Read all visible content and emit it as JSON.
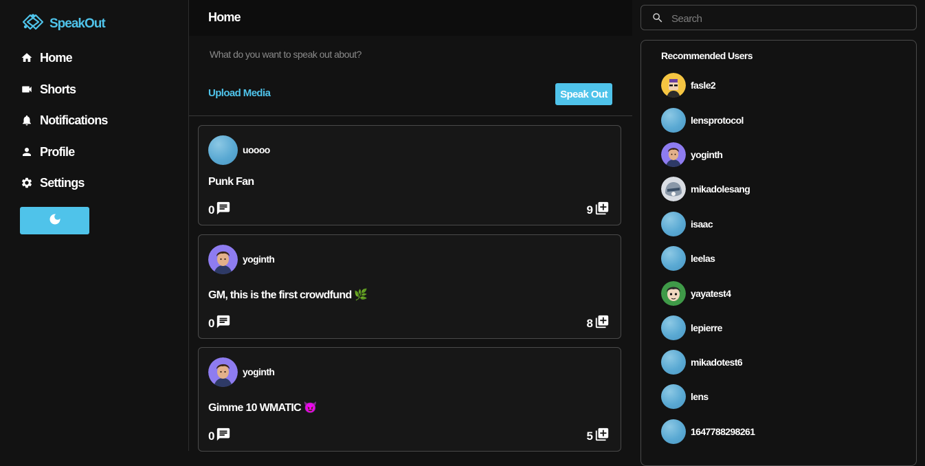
{
  "app": {
    "name": "SpeakOut"
  },
  "nav": [
    {
      "label": "Home",
      "icon": "home-icon"
    },
    {
      "label": "Shorts",
      "icon": "video-camera-icon"
    },
    {
      "label": "Notifications",
      "icon": "bell-icon"
    },
    {
      "label": "Profile",
      "icon": "person-icon"
    },
    {
      "label": "Settings",
      "icon": "gear-icon"
    }
  ],
  "theme_toggle": {
    "icon": "moon-icon"
  },
  "main": {
    "title": "Home",
    "composer": {
      "placeholder": "What do you want to speak out about?",
      "upload_label": "Upload Media",
      "submit_label": "Speak Out"
    }
  },
  "posts": [
    {
      "author": "uoooo",
      "content": "Punk Fan",
      "comments": "0",
      "collects": "9",
      "avatar": "default-blue-avatar"
    },
    {
      "author": "yoginth",
      "content": "GM, this is the first crowdfund 🌿",
      "comments": "0",
      "collects": "8",
      "avatar": "yoginth-avatar"
    },
    {
      "author": "yoginth",
      "content": "Gimme 10 WMATIC 😈",
      "comments": "0",
      "collects": "5",
      "avatar": "yoginth-avatar"
    }
  ],
  "search": {
    "placeholder": "Search",
    "icon": "search-icon"
  },
  "recommended": {
    "title": "Recommended Users",
    "users": [
      {
        "name": "fasle2",
        "avatar": "punk-avatar"
      },
      {
        "name": "lensprotocol",
        "avatar": "default-blue-avatar"
      },
      {
        "name": "yoginth",
        "avatar": "yoginth-avatar"
      },
      {
        "name": "mikadolesang",
        "avatar": "cat-avatar"
      },
      {
        "name": "isaac",
        "avatar": "default-blue-avatar"
      },
      {
        "name": "leelas",
        "avatar": "default-blue-avatar"
      },
      {
        "name": "yayatest4",
        "avatar": "boy-green-avatar"
      },
      {
        "name": "lepierre",
        "avatar": "default-blue-avatar"
      },
      {
        "name": "mikadotest6",
        "avatar": "default-blue-avatar"
      },
      {
        "name": "lens",
        "avatar": "default-blue-avatar"
      },
      {
        "name": "1647788298261",
        "avatar": "default-blue-avatar"
      }
    ]
  },
  "colors": {
    "accent": "#4fc3ea",
    "background": "#121212",
    "border": "#4a4a4a"
  }
}
